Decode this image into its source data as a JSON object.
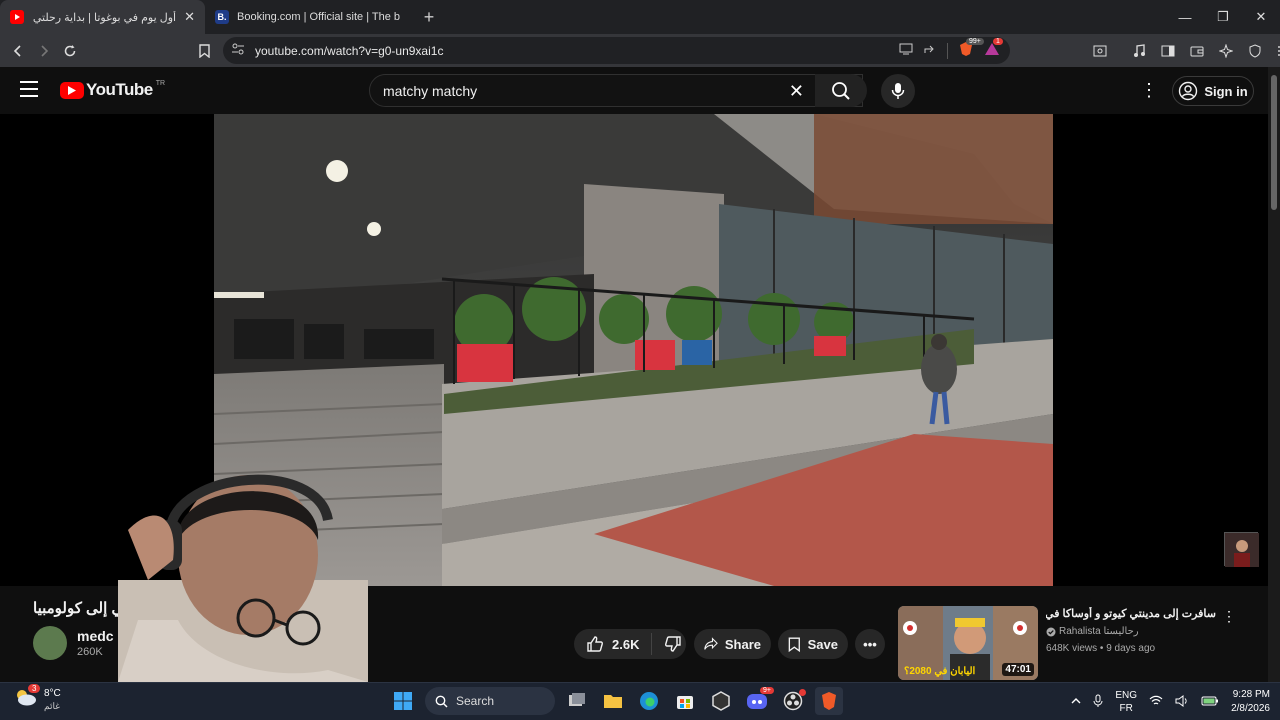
{
  "browser": {
    "tabs": [
      {
        "title": "أول يوم في بوغوتا | بداية رحلتي إلى",
        "active": true,
        "favicon": "youtube-favicon"
      },
      {
        "title": "Booking.com | Official site | The best",
        "active": false,
        "favicon": "booking-favicon",
        "favicon_letter": "B."
      }
    ],
    "new_tab": "+",
    "url": "youtube.com/watch?v=g0-un9xai1c",
    "brave_badge": "99+",
    "alert_badge": "1"
  },
  "youtube": {
    "logo_text": "YouTube",
    "country_code": "TR",
    "search_value": "matchy matchy",
    "sign_in": "Sign in"
  },
  "video": {
    "title": "رحلتي إلى كولومبيا",
    "channel_name": "medc",
    "subscribers": "260K",
    "likes": "2.6K",
    "share_label": "Share",
    "save_label": "Save"
  },
  "recommendation": {
    "title": "سافرت إلى مدينتي كيوتو و أوساكا في اليابان",
    "channel": "Rahalista رحاليستا",
    "meta": "648K views • 9 days ago",
    "duration": "47:01",
    "thumb_caption": "اليابان في 2080؟"
  },
  "taskbar": {
    "temperature": "8°C",
    "weather_sub": "غائم",
    "weather_badge": "3",
    "search_label": "Search",
    "discord_badge": "9+",
    "lang_top": "ENG",
    "lang_bottom": "FR",
    "time": "9:28 PM",
    "date": "2/8/2026"
  },
  "colors": {
    "youtube_red": "#ff0000",
    "background": "#0f0f0f",
    "taskbar": "#1c2330"
  }
}
